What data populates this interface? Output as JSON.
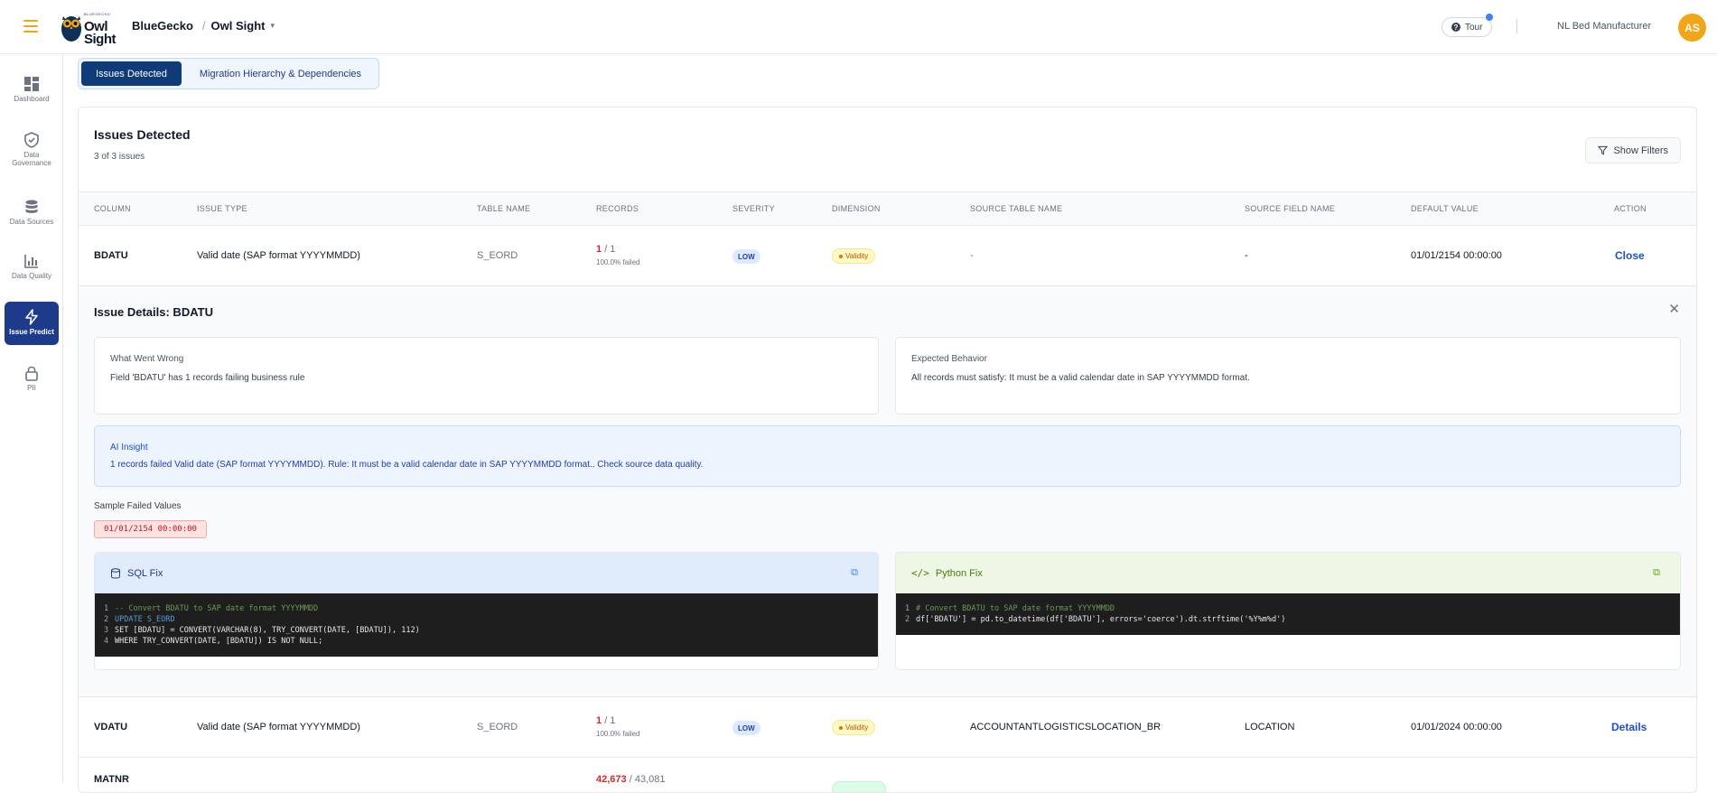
{
  "app": {
    "logo_small": "BLUEGECKO",
    "logo_line1": "Owl",
    "logo_line2": "Sight",
    "org": "BlueGecko",
    "product": "Owl Sight",
    "tour_label": "Tour",
    "company": "NL Bed Manufacturer",
    "avatar_initials": "AS",
    "accent_color": "#f2a516",
    "brand_color": "#1e3a8a"
  },
  "sidebar": {
    "items": [
      {
        "label": "Dashboard",
        "icon": "dashboard-icon"
      },
      {
        "label": "Data Governance",
        "icon": "shield-icon"
      },
      {
        "label": "Data Sources",
        "icon": "database-icon"
      },
      {
        "label": "Data Quality",
        "icon": "bar-chart-icon"
      },
      {
        "label": "Issue Predict",
        "icon": "lightning-icon",
        "active": true
      },
      {
        "label": "PII",
        "icon": "lock-icon"
      }
    ]
  },
  "tabs": [
    {
      "label": "Issues Detected",
      "active": true
    },
    {
      "label": "Migration Hierarchy & Dependencies",
      "active": false
    }
  ],
  "issues": {
    "title": "Issues Detected",
    "count_text": "3 of 3 issues",
    "filters_label": "Show Filters",
    "columns": [
      "COLUMN",
      "ISSUE TYPE",
      "TABLE NAME",
      "RECORDS",
      "SEVERITY",
      "DIMENSION",
      "SOURCE TABLE NAME",
      "SOURCE FIELD NAME",
      "DEFAULT VALUE",
      "ACTION"
    ],
    "rows": [
      {
        "column": "BDATU",
        "issue_type": "Valid date (SAP format YYYYMMDD)",
        "table_name": "S_EORD",
        "records_failed": "1",
        "records_total": "/ 1",
        "records_pct": "100.0% failed",
        "severity": "LOW",
        "dimension": "Validity",
        "source_table": "-",
        "source_field": "-",
        "default_value": "01/01/2154 00:00:00",
        "action": "Close"
      },
      {
        "column": "VDATU",
        "issue_type": "Valid date (SAP format YYYYMMDD)",
        "table_name": "S_EORD",
        "records_failed": "1",
        "records_total": "/ 1",
        "records_pct": "100.0% failed",
        "severity": "LOW",
        "dimension": "Validity",
        "source_table": "ACCOUNTANTLOGISTICSLOCATION_BR",
        "source_field": "LOCATION",
        "default_value": "01/01/2024 00:00:00",
        "action": "Details"
      },
      {
        "column": "MATNR",
        "records_failed": "42,673",
        "records_total": "/ 43,081"
      }
    ]
  },
  "details": {
    "title": "Issue Details: BDATU",
    "what_went_wrong_title": "What Went Wrong",
    "what_went_wrong_text": "Field 'BDATU' has 1 records failing business rule",
    "expected_title": "Expected Behavior",
    "expected_text": "All records must satisfy: It must be a valid calendar date in SAP YYYYMMDD format.",
    "insight_title": "AI Insight",
    "insight_text": "1 records failed Valid date (SAP format YYYYMMDD). Rule: It must be a valid calendar date in SAP YYYYMMDD format.. Check source data quality.",
    "sample_label": "Sample Failed Values",
    "sample_value": "01/01/2154 00:00:00",
    "sql_fix_title": "SQL Fix",
    "python_fix_title": "Python Fix",
    "sql_lines": [
      "-- Convert BDATU to SAP date format YYYYMMDD",
      "UPDATE S_EORD",
      "SET [BDATU] = CONVERT(VARCHAR(8), TRY_CONVERT(DATE, [BDATU]), 112)",
      "WHERE TRY_CONVERT(DATE, [BDATU]) IS NOT NULL;"
    ],
    "python_lines": [
      "# Convert BDATU to SAP date format YYYYMMDD",
      "df['BDATU'] = pd.to_datetime(df['BDATU'], errors='coerce').dt.strftime('%Y%m%d')"
    ]
  }
}
